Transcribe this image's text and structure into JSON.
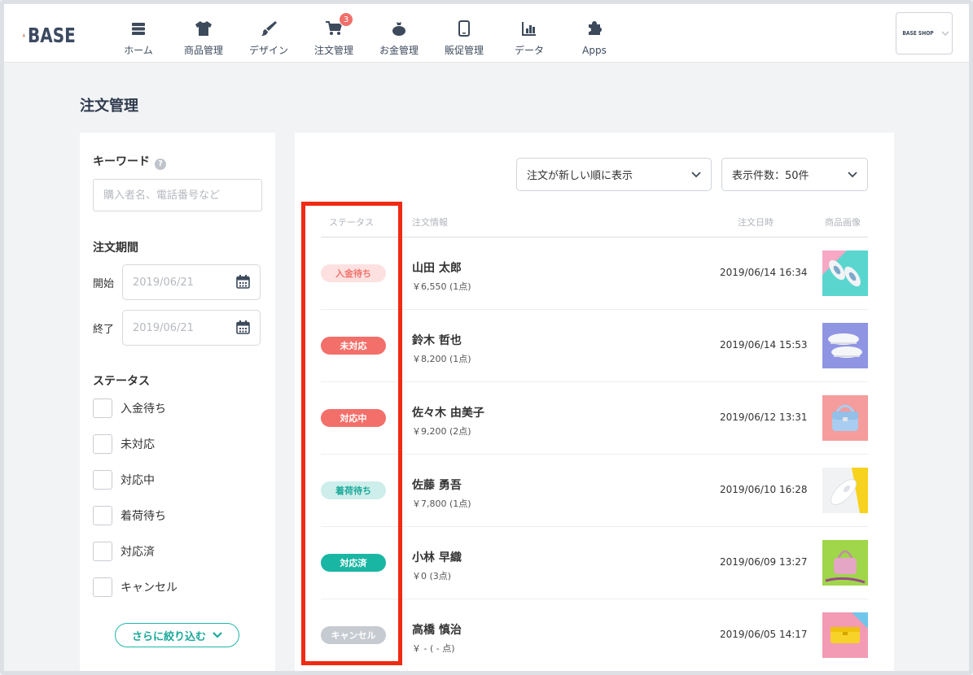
{
  "header": {
    "logo_text": "BASE",
    "nav": [
      {
        "label": "ホーム",
        "icon": "server-icon"
      },
      {
        "label": "商品管理",
        "icon": "tshirt-icon"
      },
      {
        "label": "デザイン",
        "icon": "brush-icon"
      },
      {
        "label": "注文管理",
        "icon": "cart-icon",
        "badge": "3"
      },
      {
        "label": "お金管理",
        "icon": "money-bag-icon"
      },
      {
        "label": "販促管理",
        "icon": "smartphone-icon"
      },
      {
        "label": "データ",
        "icon": "bar-chart-icon"
      },
      {
        "label": "Apps",
        "icon": "puzzle-icon"
      }
    ],
    "shop_name": "BASE SHOP"
  },
  "page": {
    "title": "注文管理"
  },
  "sidebar": {
    "keyword_label": "キーワード",
    "keyword_placeholder": "購入者名、電話番号など",
    "period_label": "注文期間",
    "start_label": "開始",
    "start_placeholder": "2019/06/21",
    "end_label": "終了",
    "end_placeholder": "2019/06/21",
    "status_label": "ステータス",
    "statuses": [
      "入金待ち",
      "未対応",
      "対応中",
      "着荷待ち",
      "対応済",
      "キャンセル"
    ],
    "more_button": "さらに絞り込む"
  },
  "main": {
    "sort_select": "注文が新しい順に表示",
    "count_select": "表示件数：50件",
    "columns": {
      "status": "ステータス",
      "info": "注文情報",
      "date": "注文日時",
      "image": "商品画像"
    },
    "orders": [
      {
        "status": "入金待ち",
        "status_bg": "#fde1e1",
        "status_fg": "#f0736c",
        "name": "山田 太郎",
        "price": "￥6,550 (1点)",
        "date": "2019/06/14 16:34",
        "image": "sneakers-teal"
      },
      {
        "status": "未対応",
        "status_bg": "#f36f6a",
        "status_fg": "#ffffff",
        "name": "鈴木 哲也",
        "price": "￥8,200 (1点)",
        "date": "2019/06/14 15:53",
        "image": "sneakers-purple"
      },
      {
        "status": "対応中",
        "status_bg": "#f36f6a",
        "status_fg": "#ffffff",
        "name": "佐々木 由美子",
        "price": "￥9,200 (2点)",
        "date": "2019/06/12 13:31",
        "image": "blue-bag-pink"
      },
      {
        "status": "着荷待ち",
        "status_bg": "#cdeeea",
        "status_fg": "#1ba99b",
        "name": "佐藤 勇吾",
        "price": "￥7,800 (1点)",
        "date": "2019/06/10 16:28",
        "image": "white-shoe-yellow"
      },
      {
        "status": "対応済",
        "status_bg": "#1ab6a4",
        "status_fg": "#ffffff",
        "name": "小林 早織",
        "price": "￥0 (3点)",
        "date": "2019/06/09 13:27",
        "image": "pink-bag-green"
      },
      {
        "status": "キャンセル",
        "status_bg": "#c6cad1",
        "status_fg": "#ffffff",
        "name": "高橋 慎治",
        "price": "￥ - ( - 点)",
        "date": "2019/06/05 14:17",
        "image": "yellow-bag-pink"
      }
    ]
  },
  "colors": {
    "accent": "#1ab6a4",
    "highlight": "#ef2b13",
    "badge": "#f06f6a"
  }
}
